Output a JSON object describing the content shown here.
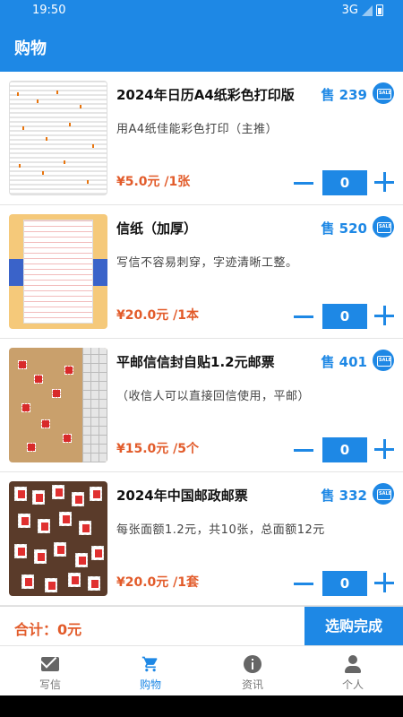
{
  "status": {
    "time": "19:50",
    "network": "3G"
  },
  "appbar": {
    "title": "购物"
  },
  "products": [
    {
      "name": "2024年日历A4纸彩色打印版",
      "sold": "售 239",
      "desc": "用A4纸佳能彩色打印（主推）",
      "price": "¥5.0元 /1张",
      "qty": "0"
    },
    {
      "name": "信纸（加厚）",
      "sold": "售 520",
      "desc": "写信不容易刺穿，字迹清晰工整。",
      "price": "¥20.0元 /1本",
      "qty": "0"
    },
    {
      "name": "平邮信信封自贴1.2元邮票",
      "sold": "售 401",
      "desc": "（收信人可以直接回信使用，平邮）",
      "price": "¥15.0元 /5个",
      "qty": "0"
    },
    {
      "name": "2024年中国邮政邮票",
      "sold": "售 332",
      "desc": "每张面额1.2元，共10张，总面额12元",
      "price": "¥20.0元 /1套",
      "qty": "0"
    }
  ],
  "sale_badge": "SALE",
  "footer": {
    "total": "合计：0元",
    "done_label": "选购完成"
  },
  "tabs": [
    {
      "label": "写信",
      "icon": "mail-icon"
    },
    {
      "label": "购物",
      "icon": "cart-icon"
    },
    {
      "label": "资讯",
      "icon": "info-icon"
    },
    {
      "label": "个人",
      "icon": "person-icon"
    }
  ],
  "colors": {
    "primary": "#1e88e5",
    "price": "#e25b2a"
  }
}
